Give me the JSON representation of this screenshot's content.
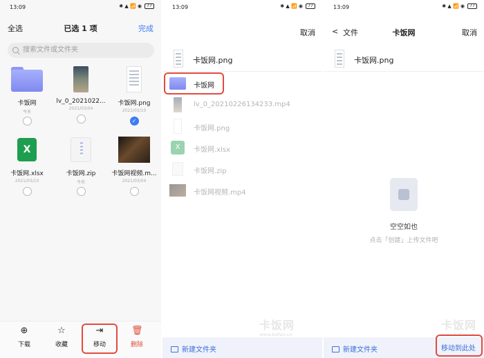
{
  "status": {
    "time": "13:09",
    "icons_text": "✱ ▲ 📶 ◉",
    "battery": "77"
  },
  "panel1": {
    "select_all": "全选",
    "title": "已选 1 项",
    "done": "完成",
    "search_placeholder": "搜索文件或文件夹",
    "items": [
      {
        "name": "卡饭网",
        "date": "今天",
        "type": "folder",
        "checked": false
      },
      {
        "name": "lv_0_2021022...",
        "date": "2021/03/04",
        "type": "video-phone",
        "checked": false
      },
      {
        "name": "卡饭网.png",
        "date": "2021/03/10",
        "type": "png",
        "checked": true
      },
      {
        "name": "卡饭网.xlsx",
        "date": "2021/03/10",
        "type": "xlsx",
        "checked": false
      },
      {
        "name": "卡饭网.zip",
        "date": "今天",
        "type": "zip",
        "checked": false
      },
      {
        "name": "卡饭网视频.m...",
        "date": "2021/03/04",
        "type": "video",
        "checked": false
      }
    ],
    "bottom": [
      {
        "label": "下载",
        "icon": "download-icon",
        "glyph": "⊕"
      },
      {
        "label": "收藏",
        "icon": "star-icon",
        "glyph": "☆"
      },
      {
        "label": "移动",
        "icon": "move-icon",
        "glyph": "⇥"
      },
      {
        "label": "删除",
        "icon": "trash-icon",
        "glyph": "🗑"
      }
    ]
  },
  "panel2": {
    "cancel": "取消",
    "moving_file": "卡饭网.png",
    "list": [
      {
        "label": "卡饭网",
        "type": "folder",
        "dim": false
      },
      {
        "label": "lv_0_20210226134233.mp4",
        "type": "phone",
        "dim": true
      },
      {
        "label": "卡饭网.png",
        "type": "png",
        "dim": true
      },
      {
        "label": "卡饭网.xlsx",
        "type": "xlsx",
        "dim": true
      },
      {
        "label": "卡饭网.zip",
        "type": "zip",
        "dim": true
      },
      {
        "label": "卡饭网视频.mp4",
        "type": "video",
        "dim": true
      }
    ],
    "new_folder": "新建文件夹"
  },
  "panel3": {
    "back": "<",
    "crumb": "文件",
    "title": "卡饭网",
    "cancel": "取消",
    "moving_file": "卡饭网.png",
    "empty_title": "空空如也",
    "empty_hint": "点击「创建」上传文件吧",
    "new_folder": "新建文件夹",
    "move_here": "移动到此处"
  },
  "watermark": {
    "text": "卡饭网",
    "sub": "www.kafan.cn"
  },
  "colors": {
    "accent": "#3d7cf2",
    "highlight": "#e24a3e",
    "folder": "#8e96f5",
    "excel": "#1e9e4f"
  }
}
